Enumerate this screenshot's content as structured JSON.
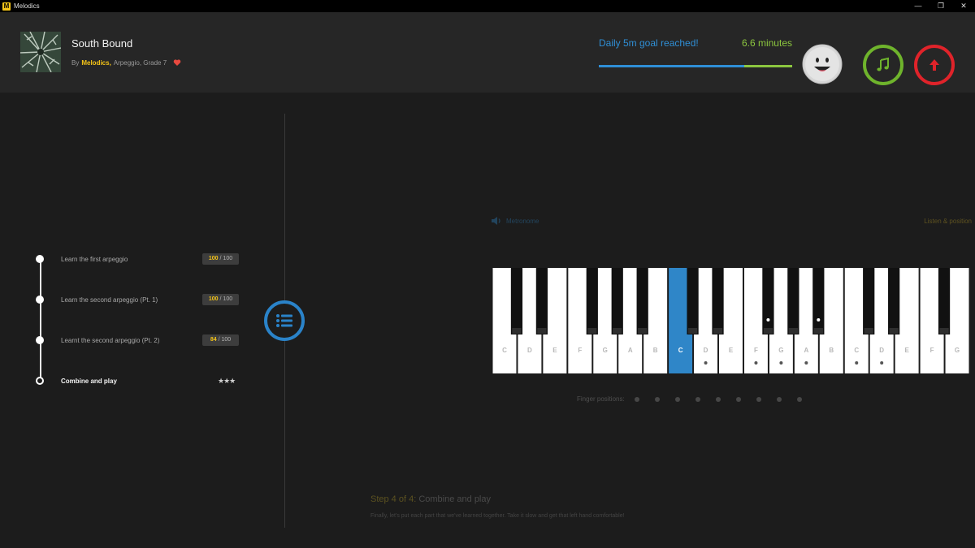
{
  "window": {
    "app_icon": "M",
    "title": "Melodics",
    "controls": {
      "minimize": "—",
      "restore": "❐",
      "close": "✕"
    }
  },
  "header": {
    "song_title": "South Bound",
    "meta_prefix": "By",
    "artist": "Melodics,",
    "meta_suffix": "Arpeggio, Grade 7",
    "goal_text": "Daily 5m goal reached!",
    "goal_minutes": "6.6 minutes",
    "goal_blue_fraction": 0.75,
    "colors": {
      "goal_blue": "#2f8fd6",
      "goal_green": "#8cc63f",
      "music_button": "#6fb42c",
      "upload_button": "#e0232a",
      "accent": "#f5c518"
    },
    "icons": {
      "heart": "heart-icon",
      "avatar": "smiley-face-icon",
      "music": "music-note-icon",
      "upload": "arrow-up-icon"
    }
  },
  "steps": [
    {
      "label": "Learn the first arpeggio",
      "score": "100",
      "total": "/ 100"
    },
    {
      "label": "Learn the second arpeggio (Pt. 1)",
      "score": "100",
      "total": "/ 100"
    },
    {
      "label": "Learnt the second arpeggio (Pt. 2)",
      "score": "84",
      "total": "/ 100"
    },
    {
      "label": "Combine and play",
      "stars": "★★★"
    }
  ],
  "player": {
    "speaker_label": "Metronome",
    "listen_label": "Listen & position",
    "keyboard": {
      "white_keys": [
        "C",
        "D",
        "E",
        "F",
        "G",
        "A",
        "B",
        "C",
        "D",
        "E",
        "F",
        "G",
        "A",
        "B",
        "C",
        "D",
        "E",
        "F",
        "G"
      ],
      "active_white_index": 7,
      "white_key_dots": [
        8,
        10,
        11,
        12,
        14,
        15
      ],
      "black_key_dots": [
        7,
        9
      ],
      "colors": {
        "active": "#2f86c8"
      }
    },
    "finger_label": "Finger positions:",
    "finger_count": 9,
    "step_heading_num": "Step 4 of 4:",
    "step_heading": "Combine and play",
    "step_desc": "Finally, let's put each part that we've learned together. Take it slow and get that left hand comfortable!"
  }
}
